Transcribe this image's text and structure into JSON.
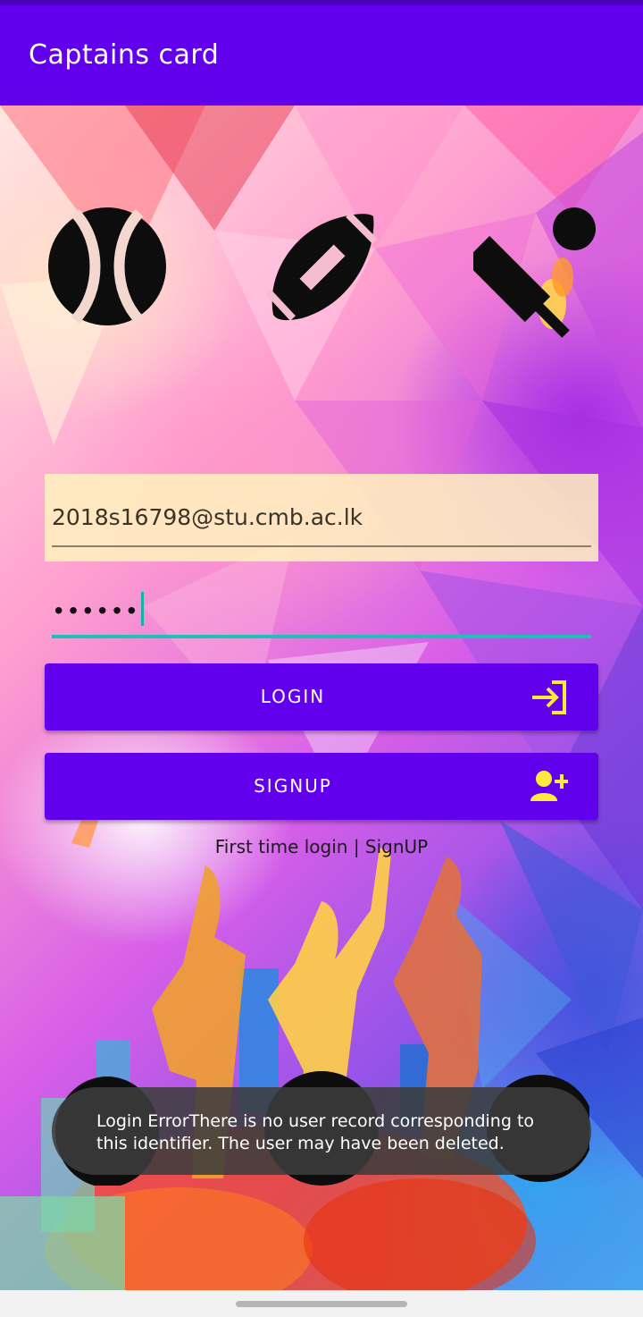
{
  "app_bar": {
    "title": "Captains card"
  },
  "sport_icons": [
    "tennis-ball-icon",
    "rugby-ball-icon",
    "cricket-bat-ball-icon"
  ],
  "form": {
    "email_value": "2018s16798@stu.cmb.ac.lk",
    "password_masked": "••••••"
  },
  "buttons": {
    "login_label": "LOGIN",
    "login_icon": "login-arrow-icon",
    "signup_label": "SIGNUP",
    "signup_icon": "add-user-icon"
  },
  "hint": {
    "prefix": "First time login | ",
    "link": "SignUP"
  },
  "toast": {
    "message": "Login ErrorThere is no user record corresponding to this identifier. The user may have been deleted."
  },
  "colors": {
    "primary": "#6200ee",
    "accent": "#1ec0b8",
    "icon_yellow": "#ffeb3b"
  }
}
